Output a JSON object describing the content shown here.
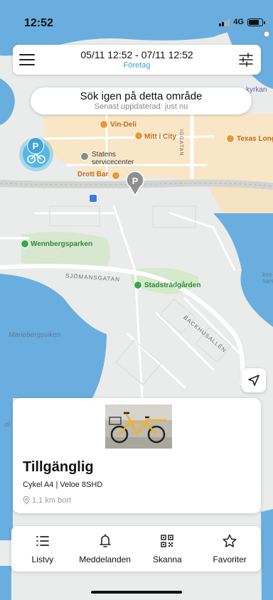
{
  "status_bar": {
    "time": "12:52",
    "network": "4G",
    "signal_bars_active": 2,
    "signal_bars_total": 4,
    "battery_level": 0.8
  },
  "top_bar": {
    "date_range": "05/11 12:52 - 07/11 12:52",
    "subtitle": "Företag",
    "subtitle_color": "#3aa0d8",
    "menu_icon": "hamburger-menu-icon",
    "filter_icon": "sliders-icon"
  },
  "search_area": {
    "title": "Sök igen på detta område",
    "subtitle": "Senast uppdaterad: just nu"
  },
  "map": {
    "labels": {
      "vin_deli": "Vin-Deli",
      "mitt_i_city": "Mitt i City",
      "texas_long": "Texas Long",
      "statens_1": "Statens",
      "statens_2": "servicecenter",
      "drott_bar": "Drott Bar",
      "kyrkan": "kyrkan",
      "iggatan": "IGGATAN",
      "wennbergsparken": "Wennbergsparken",
      "sjomansgatan": "SJÖMANSGATAN",
      "stadstradgarden": "Stadsträdgården",
      "backhusallen": "BACKHUSALLÉN",
      "mariebergsviken": "Mariebergsviken",
      "inre_1": "Inre",
      "inre_2": "hamn",
      "edge_left": "ol"
    },
    "marker_icons": [
      "bike-cluster-icon",
      "parking-pin-icon"
    ],
    "parking_letter": "P",
    "colors": {
      "land": "#e9ecea",
      "water": "#6aaedf",
      "city": "#f8e6c6",
      "park": "#cfe6c4",
      "marker": "#58b7e3"
    }
  },
  "bike_card": {
    "status": "Tillgänglig",
    "model": "Cykel A4 | Veloe 8SHD",
    "distance": "1,1 km bort",
    "bike_color": "#f5b21b"
  },
  "bottom_nav": {
    "items": [
      {
        "label": "Listvy",
        "icon": "list-icon"
      },
      {
        "label": "Meddelanden",
        "icon": "bell-icon"
      },
      {
        "label": "Skanna",
        "icon": "qr-code-icon"
      },
      {
        "label": "Favoriter",
        "icon": "star-icon"
      }
    ]
  }
}
